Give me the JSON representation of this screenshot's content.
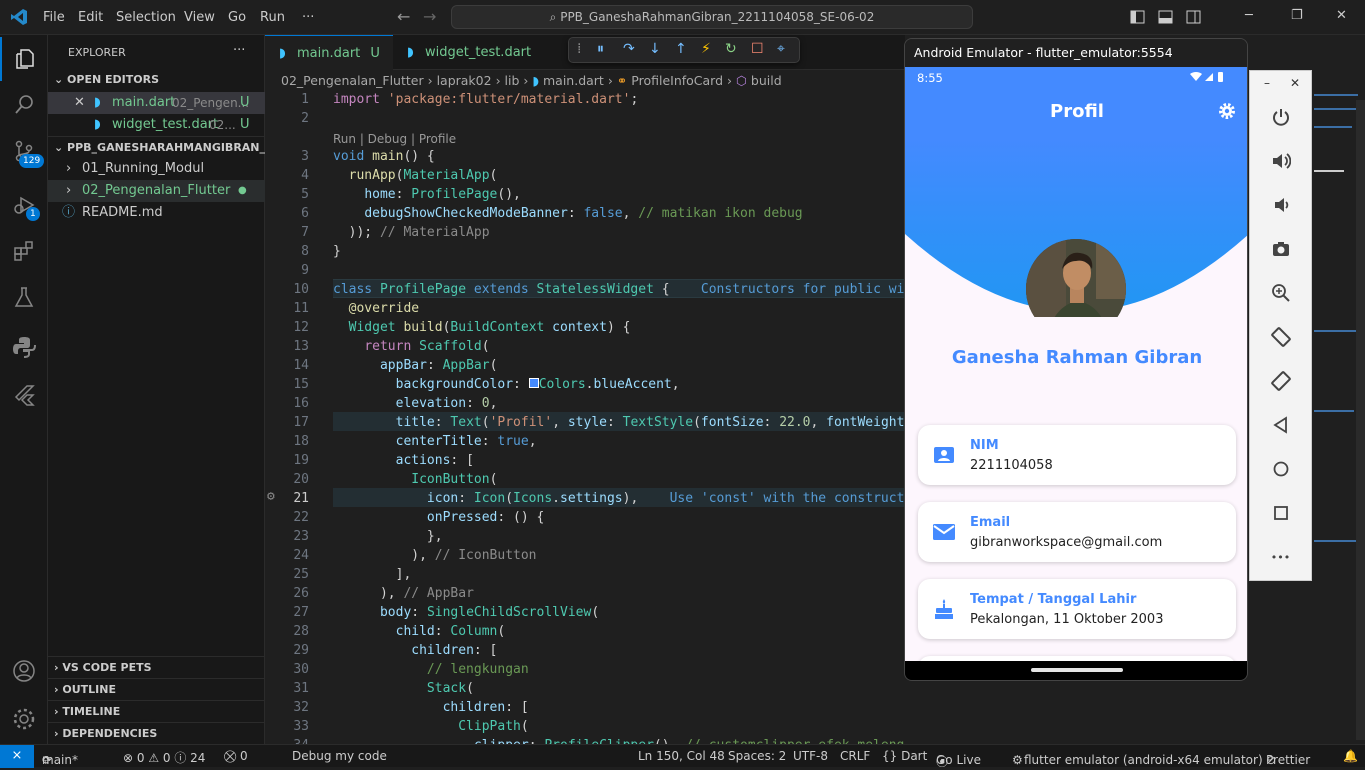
{
  "titlebar": {
    "menu": [
      "File",
      "Edit",
      "Selection",
      "View",
      "Go",
      "Run",
      "···"
    ],
    "search": "PPB_GaneshaRahmanGibran_2211104058_SE-06-02"
  },
  "activity": {
    "scm_badge": "129",
    "debug_badge": "1"
  },
  "sidebar": {
    "title": "EXPLORER",
    "more": "···",
    "open_editors": "OPEN EDITORS",
    "open_files": [
      {
        "name": "main.dart",
        "path": "02_Pengen...",
        "status": "U"
      },
      {
        "name": "widget_test.dart",
        "path": "02...",
        "status": "U"
      }
    ],
    "project": "PPB_GANESHARAHMANGIBRAN_2...",
    "tree": [
      {
        "label": "01_Running_Modul"
      },
      {
        "label": "02_Pengenalan_Flutter"
      },
      {
        "label": "README.md"
      }
    ],
    "bottom": [
      "VS CODE PETS",
      "OUTLINE",
      "TIMELINE",
      "DEPENDENCIES"
    ]
  },
  "tabs": [
    {
      "label": "main.dart",
      "status": "U"
    },
    {
      "label": "widget_test.dart",
      "status": "U"
    }
  ],
  "breadcrumb": [
    "02_Pengenalan_Flutter",
    "laprak02",
    "lib",
    "main.dart",
    "ProfileInfoCard",
    "build"
  ],
  "codelens": "Run | Debug | Profile",
  "line_numbers": [
    "1",
    "2",
    "3",
    "4",
    "5",
    "6",
    "7",
    "8",
    "9",
    "10",
    "11",
    "12",
    "13",
    "14",
    "15",
    "16",
    "17",
    "18",
    "19",
    "20",
    "21",
    "22",
    "23",
    "24",
    "25",
    "26",
    "27",
    "28",
    "29",
    "30",
    "31",
    "32",
    "33",
    "34"
  ],
  "emulator": {
    "title": "Android Emulator - flutter_emulator:5554",
    "time": "8:55",
    "appbar_title": "Profil",
    "name": "Ganesha Rahman Gibran",
    "cards": [
      {
        "label": "NIM",
        "value": "2211104058",
        "icon": "badge-icon"
      },
      {
        "label": "Email",
        "value": "gibranworkspace@gmail.com",
        "icon": "email-icon"
      },
      {
        "label": "Tempat / Tanggal Lahir",
        "value": "Pekalongan, 11 Oktober 2003",
        "icon": "cake-icon"
      }
    ],
    "colors": {
      "primary": "#448aff",
      "background": "#fdf6fd"
    }
  },
  "emulator_side": {
    "minimize": "–",
    "close": "✕",
    "more": "•••"
  },
  "statusbar": {
    "remote": "⨯",
    "branch": "main*",
    "problems": "⊗ 0 ⚠ 0 ⓘ 24",
    "ports": "⛒ 0",
    "debug": "Debug my code",
    "position": "Ln 150, Col 48",
    "spaces": "Spaces: 2",
    "encoding": "UTF-8",
    "eol": "CRLF",
    "language": "{} Dart",
    "golive": "Go Live",
    "device": "flutter emulator (android-x64 emulator)",
    "prettier": "Prettier"
  }
}
